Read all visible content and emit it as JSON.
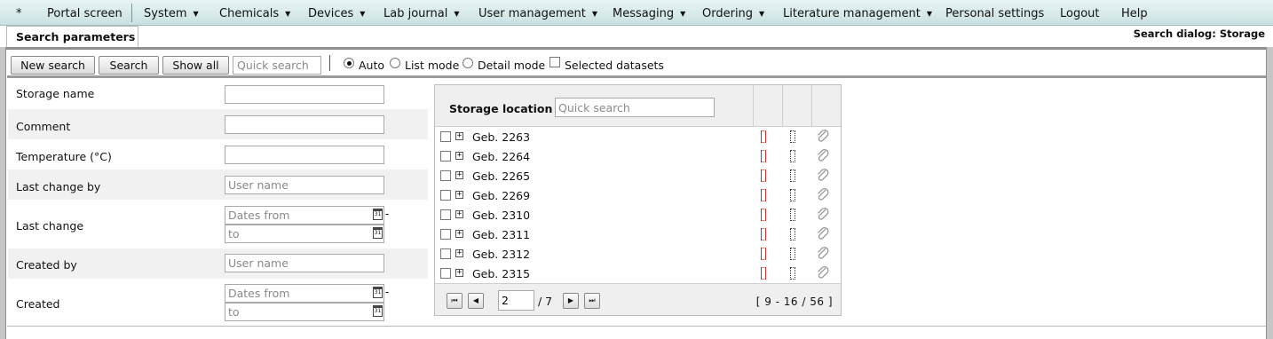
{
  "menu": {
    "items": [
      {
        "label": "*",
        "dropdown": false
      },
      {
        "label": "Portal screen",
        "dropdown": false
      },
      {
        "label": "System",
        "dropdown": true
      },
      {
        "label": "Chemicals",
        "dropdown": true
      },
      {
        "label": "Devices",
        "dropdown": true
      },
      {
        "label": "Lab journal",
        "dropdown": true
      },
      {
        "label": "User management",
        "dropdown": true
      },
      {
        "label": "Messaging",
        "dropdown": true
      },
      {
        "label": "Ordering",
        "dropdown": true
      },
      {
        "label": "Literature management",
        "dropdown": true
      },
      {
        "label": "Personal settings",
        "dropdown": false
      },
      {
        "label": "Logout",
        "dropdown": false
      },
      {
        "label": "Help",
        "dropdown": false
      }
    ],
    "caret_glyph": "▼"
  },
  "tab": {
    "label": "Search parameters"
  },
  "dialog_title": "Search dialog: Storage",
  "toolbar": {
    "new_search": "New search",
    "search": "Search",
    "show_all": "Show all",
    "quick_search_placeholder": "Quick search",
    "modes": [
      {
        "label": "Auto",
        "selected": true
      },
      {
        "label": "List mode",
        "selected": false
      },
      {
        "label": "Detail mode",
        "selected": false
      }
    ],
    "selected_datasets": {
      "label": "Selected datasets",
      "checked": false
    }
  },
  "form": {
    "storage_name": {
      "label": "Storage name",
      "value": ""
    },
    "comment": {
      "label": "Comment",
      "value": ""
    },
    "temperature": {
      "label": "Temperature (°C)",
      "value": ""
    },
    "last_change_by": {
      "label": "Last change by",
      "placeholder": "User name"
    },
    "last_change": {
      "label": "Last change",
      "from_placeholder": "Dates from",
      "to_placeholder": "to"
    },
    "created_by": {
      "label": "Created by",
      "placeholder": "User name"
    },
    "created": {
      "label": "Created",
      "from_placeholder": "Dates from",
      "to_placeholder": "to"
    },
    "range_dash": "-",
    "calendar_glyph": "31"
  },
  "storage_panel": {
    "title": "Storage location",
    "quick_search_placeholder": "Quick search",
    "expander_glyph": "+",
    "rows": [
      {
        "name": "Geb. 2263"
      },
      {
        "name": "Geb. 2264"
      },
      {
        "name": "Geb. 2265"
      },
      {
        "name": "Geb. 2269"
      },
      {
        "name": "Geb. 2310"
      },
      {
        "name": "Geb. 2311"
      },
      {
        "name": "Geb. 2312"
      },
      {
        "name": "Geb. 2315"
      }
    ],
    "pager": {
      "first_glyph": "⏮",
      "prev_glyph": "◀",
      "next_glyph": "▶",
      "last_glyph": "⏭",
      "current_page": "2",
      "total_pages": "/ 7",
      "range_text": "[ 9 - 16 / 56 ]"
    }
  },
  "colors": {
    "menu_bg": "#c9e1e1",
    "frame_gray": "#8f8f8f",
    "alt_row": "#f1f1f1",
    "mark_red": "#b33333"
  }
}
